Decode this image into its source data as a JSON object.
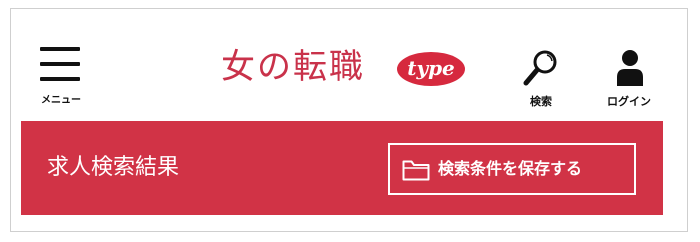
{
  "header": {
    "menu_label": "メニュー",
    "logo_text": "女の転職",
    "logo_badge": "type",
    "search_label": "検索",
    "login_label": "ログイン"
  },
  "banner": {
    "title": "求人検索結果",
    "save_button_label": "検索条件を保存する"
  },
  "colors": {
    "brand_red": "#d13346",
    "logo_pink": "#c9324a",
    "text_dark": "#111111"
  },
  "icons": [
    "menu-icon",
    "search-icon",
    "user-icon",
    "folder-icon"
  ]
}
